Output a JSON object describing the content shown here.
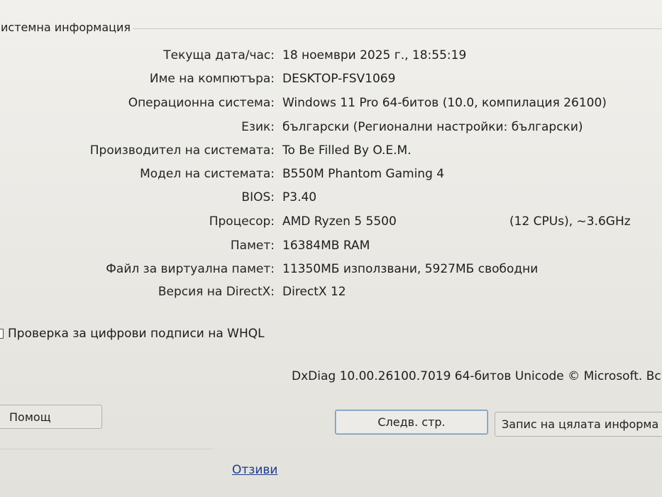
{
  "section_title": "истемна информация",
  "system_info": [
    {
      "label": "Текуща дата/час:",
      "value": "18 ноември 2025 г., 18:55:19"
    },
    {
      "label": "Име на компютъра:",
      "value": "DESKTOP-FSV1069"
    },
    {
      "label": "Операционна система:",
      "value": "Windows 11 Pro 64-битов (10.0, компилация 26100)"
    },
    {
      "label": "Език:",
      "value": "български (Регионални настройки: български)"
    },
    {
      "label": "Производител на системата:",
      "value": "To Be Filled By O.E.M."
    },
    {
      "label": "Модел на системата:",
      "value": "B550M Phantom Gaming 4"
    },
    {
      "label": "BIOS:",
      "value": "P3.40"
    },
    {
      "label": "Процесор:",
      "value": "AMD Ryzen 5 5500",
      "extra": "(12 CPUs), ~3.6GHz"
    },
    {
      "label": "Памет:",
      "value": "16384MB RAM"
    },
    {
      "label": "Файл за виртуална памет:",
      "value": "11350МБ използвани, 5927МБ свободни"
    },
    {
      "label": "Версия на DirectX:",
      "value": "DirectX 12"
    }
  ],
  "whql_checkbox": {
    "label": "Проверка за цифрови подписи на WHQL",
    "checked": false
  },
  "version_text": "DxDiag 10.00.26100.7019 64-битов Unicode © Microsoft. Всич",
  "buttons": {
    "help": "Помощ",
    "next_page": "Следв. стр.",
    "save_all": "Запис на цялата информа"
  },
  "feedback_link": "Отзиви"
}
